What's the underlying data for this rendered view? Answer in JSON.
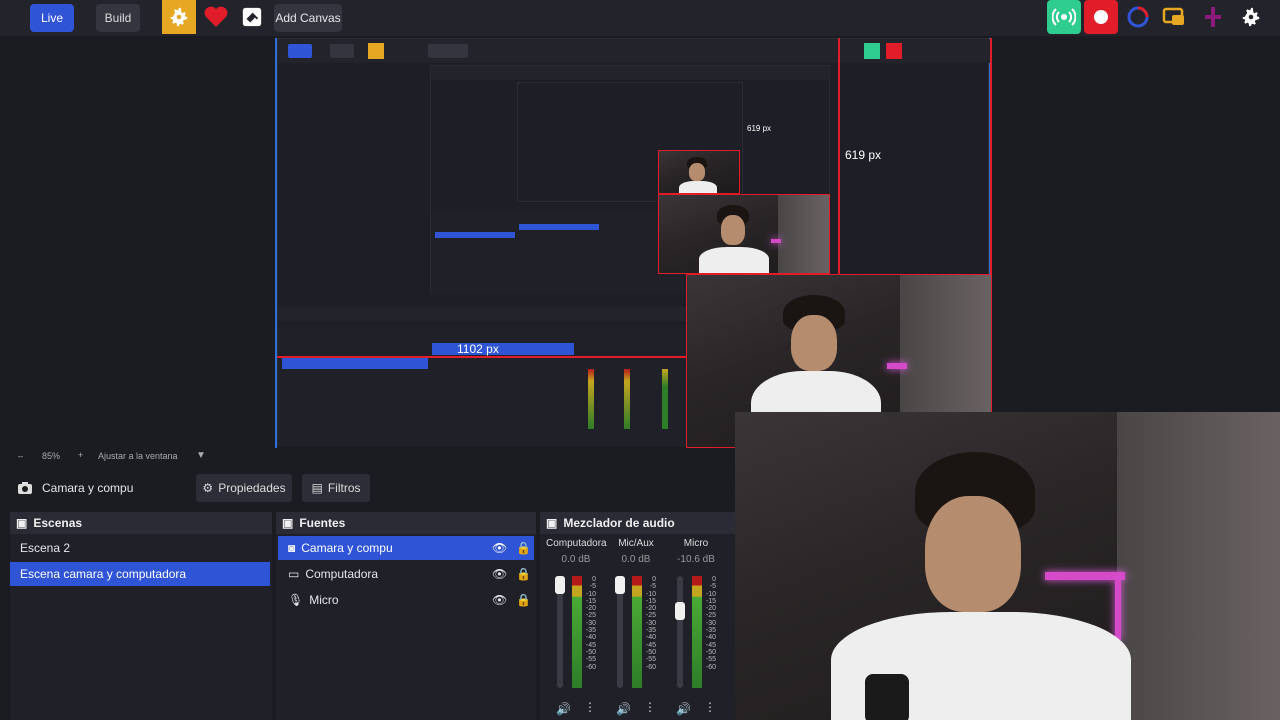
{
  "topbar": {
    "live_label": "Live",
    "build_label": "Build",
    "add_canvas_label": "Add Canvas"
  },
  "preview": {
    "height_label": "619 px",
    "width_label": "1102 px",
    "nested_height_label": "619 px"
  },
  "zoom": {
    "minus": "–",
    "value": "85%",
    "plus": "+",
    "fit_label": "Ajustar a la ventana"
  },
  "toolbar": {
    "source_name": "Camara y compu",
    "properties_label": "Propiedades",
    "filters_label": "Filtros"
  },
  "scenes": {
    "title": "Escenas",
    "items": [
      "Escena 2",
      "Escena camara y computadora"
    ]
  },
  "sources": {
    "title": "Fuentes",
    "items": [
      "Camara y compu",
      "Computadora",
      "Micro"
    ]
  },
  "mixer": {
    "title": "Mezclador de audio",
    "channels": [
      {
        "name": "Computadora",
        "db": "0.0 dB",
        "level": 1.0
      },
      {
        "name": "Mic/Aux",
        "db": "0.0 dB",
        "level": 1.0
      },
      {
        "name": "Micro",
        "db": "-10.6 dB",
        "level": 0.72
      }
    ],
    "ticks": [
      "0",
      "-5",
      "-10",
      "-15",
      "-20",
      "-25",
      "-30",
      "-35",
      "-40",
      "-45",
      "-50",
      "-55",
      "-60"
    ]
  },
  "colors": {
    "accent": "#2f54d6",
    "record": "#e11d2a",
    "stream": "#2ecc8f",
    "settings": "#e6a823"
  }
}
